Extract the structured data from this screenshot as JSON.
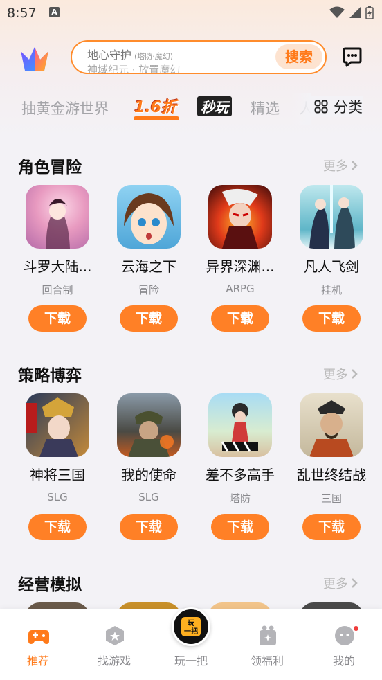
{
  "status_bar": {
    "time": "8:57",
    "notif": "A"
  },
  "search": {
    "placeholder_line1": "地心守护",
    "placeholder_tag": "(塔防·魔幻)",
    "placeholder_line2": "神域纪元 · 放置魔幻",
    "button_label": "搜索"
  },
  "tabs": {
    "gold": "抽黄金游世界",
    "discount": "1.6折",
    "miaowan": "秒玩",
    "jingxuan": "精选",
    "cut": "人",
    "category": "分类"
  },
  "more_label": "更多",
  "download_label": "下载",
  "sections": [
    {
      "title": "角色冒险",
      "games": [
        {
          "name": "斗罗大陆...",
          "tag": "回合制"
        },
        {
          "name": "云海之下",
          "tag": "冒险"
        },
        {
          "name": "异界深渊...",
          "tag": "ARPG"
        },
        {
          "name": "凡人飞剑",
          "tag": "挂机"
        }
      ]
    },
    {
      "title": "策略博弈",
      "games": [
        {
          "name": "神将三国",
          "tag": "SLG"
        },
        {
          "name": "我的使命",
          "tag": "SLG"
        },
        {
          "name": "差不多高手",
          "tag": "塔防"
        },
        {
          "name": "乱世终结战",
          "tag": "三国"
        }
      ]
    },
    {
      "title": "经营模拟",
      "games": []
    }
  ],
  "bottom_nav": [
    {
      "label": "推荐",
      "active": true
    },
    {
      "label": "找游戏",
      "active": false
    },
    {
      "label": "玩一把",
      "active": false
    },
    {
      "label": "领福利",
      "active": false
    },
    {
      "label": "我的",
      "active": false
    }
  ],
  "play_badge": "玩一把",
  "colors": {
    "accent": "#ff8026",
    "active": "#ff7a1a",
    "badge": "#f03c3c"
  }
}
